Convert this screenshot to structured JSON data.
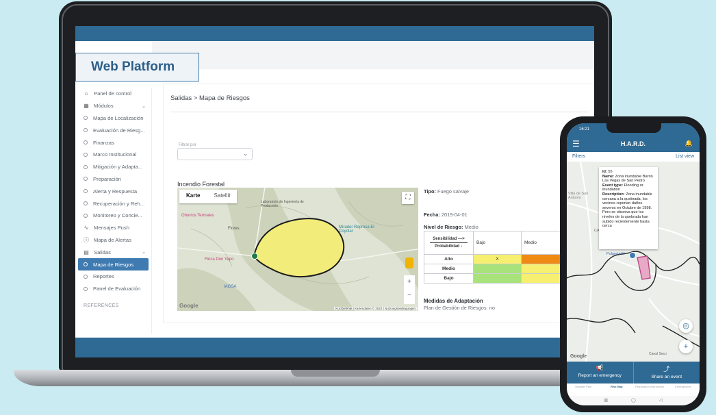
{
  "platform": {
    "title": "Web Platform"
  },
  "sidebar": {
    "items": [
      {
        "label": "Panel de control",
        "icon": "home-icon"
      },
      {
        "label": "Módulos",
        "icon": "grid-icon",
        "expandable": true
      },
      {
        "label": "Mapa de Localización"
      },
      {
        "label": "Evaluación de Riesg..."
      },
      {
        "label": "Finanzas"
      },
      {
        "label": "Marco Institucional"
      },
      {
        "label": "Mitigación y Adapta..."
      },
      {
        "label": "Preparación"
      },
      {
        "label": "Alerta y Respuesta"
      },
      {
        "label": "Recuperación y Reh..."
      },
      {
        "label": "Monitoreo y Concie..."
      },
      {
        "label": "Mensajes Push",
        "icon": "pulse-icon"
      },
      {
        "label": "Mapa de Alertas",
        "icon": "alert-circle-icon"
      },
      {
        "label": "Salidas",
        "icon": "document-icon",
        "expandable": true
      },
      {
        "label": "Mapa de Riesgos",
        "active": true
      },
      {
        "label": "Reportes"
      },
      {
        "label": "Panel de Evaluación"
      }
    ],
    "references_label": "REFERENCES"
  },
  "main": {
    "breadcrumb": "Salidas > Mapa de Riesgos",
    "filter": {
      "label": "Filtrar por",
      "value": ""
    },
    "risk": {
      "title": "Incendio Forestal",
      "tipo_label": "Tipo:",
      "tipo_value": "Fuego salvaje",
      "fecha_label": "Fecha:",
      "fecha_value": "2019-04-01",
      "nivel_label": "Nivel de Riesgo:",
      "nivel_value": "Medio",
      "medidas_title": "Medidas de Adaptación",
      "medidas_value": "Plan de Gestión de Riesgos: no"
    },
    "map": {
      "tabs": [
        "Karte",
        "Satellit"
      ],
      "active_tab": "Karte",
      "places": [
        "Ohorros Termales",
        "Flores",
        "Finca Don Yapo",
        "IAGSA",
        "Mirador Represa El Coyolar",
        "Laboratorio de Ingeniería de Producción"
      ],
      "google": "Google",
      "footer": "Kurzbefehle | Kartendaten © 2022 | Nutzungsbedingungen",
      "polygon_fill": "#f2ec7a"
    },
    "matrix": {
      "axis_top": "Sensibilidad —>",
      "axis_bottom": "Probabilidad ↓",
      "columns": [
        "Bajo",
        "Medio"
      ],
      "rows": [
        {
          "label": "Alto",
          "cells": [
            {
              "text": "X",
              "color": "#f6ef6f"
            },
            {
              "text": "",
              "color": "#ef8a14"
            }
          ]
        },
        {
          "label": "Medio",
          "cells": [
            {
              "text": "",
              "color": "#a8e27a"
            },
            {
              "text": "",
              "color": "#f6ef6f"
            }
          ]
        },
        {
          "label": "Bajo",
          "cells": [
            {
              "text": "",
              "color": "#a8e27a"
            },
            {
              "text": "",
              "color": "#f6ef6f"
            }
          ]
        }
      ]
    }
  },
  "phone": {
    "time": "16:21",
    "title": "H.A.R.D.",
    "filters": "Filters",
    "list_view": "List view",
    "popup": {
      "id_label": "Id:",
      "id_value": "55",
      "name_label": "Name:",
      "name_value": "Zona inundable Barrio Las Vegas de San Pedro",
      "event_label": "Event type:",
      "event_value": "Flooding or inundation",
      "desc_label": "Description:",
      "desc_value": "Zona inundable cercana a la quebrada, los vecinos reportan daños severos en Octubre de 1998. Pero se observa que los niveles de la quebrada han subido recientemente hasta cerca"
    },
    "map_labels": [
      "Villa de San Antonio",
      "Pulpería M",
      "Canal Seco",
      "CA"
    ],
    "google": "Google",
    "actions": [
      {
        "label": "Report an emergency",
        "icon": "megaphone-icon"
      },
      {
        "label": "Share an event",
        "icon": "share-icon"
      }
    ],
    "nav": [
      "Disaster Plan",
      "Risk Map",
      "Preparation Instructions",
      "Emergencies"
    ],
    "accent": "#2f6a94"
  }
}
